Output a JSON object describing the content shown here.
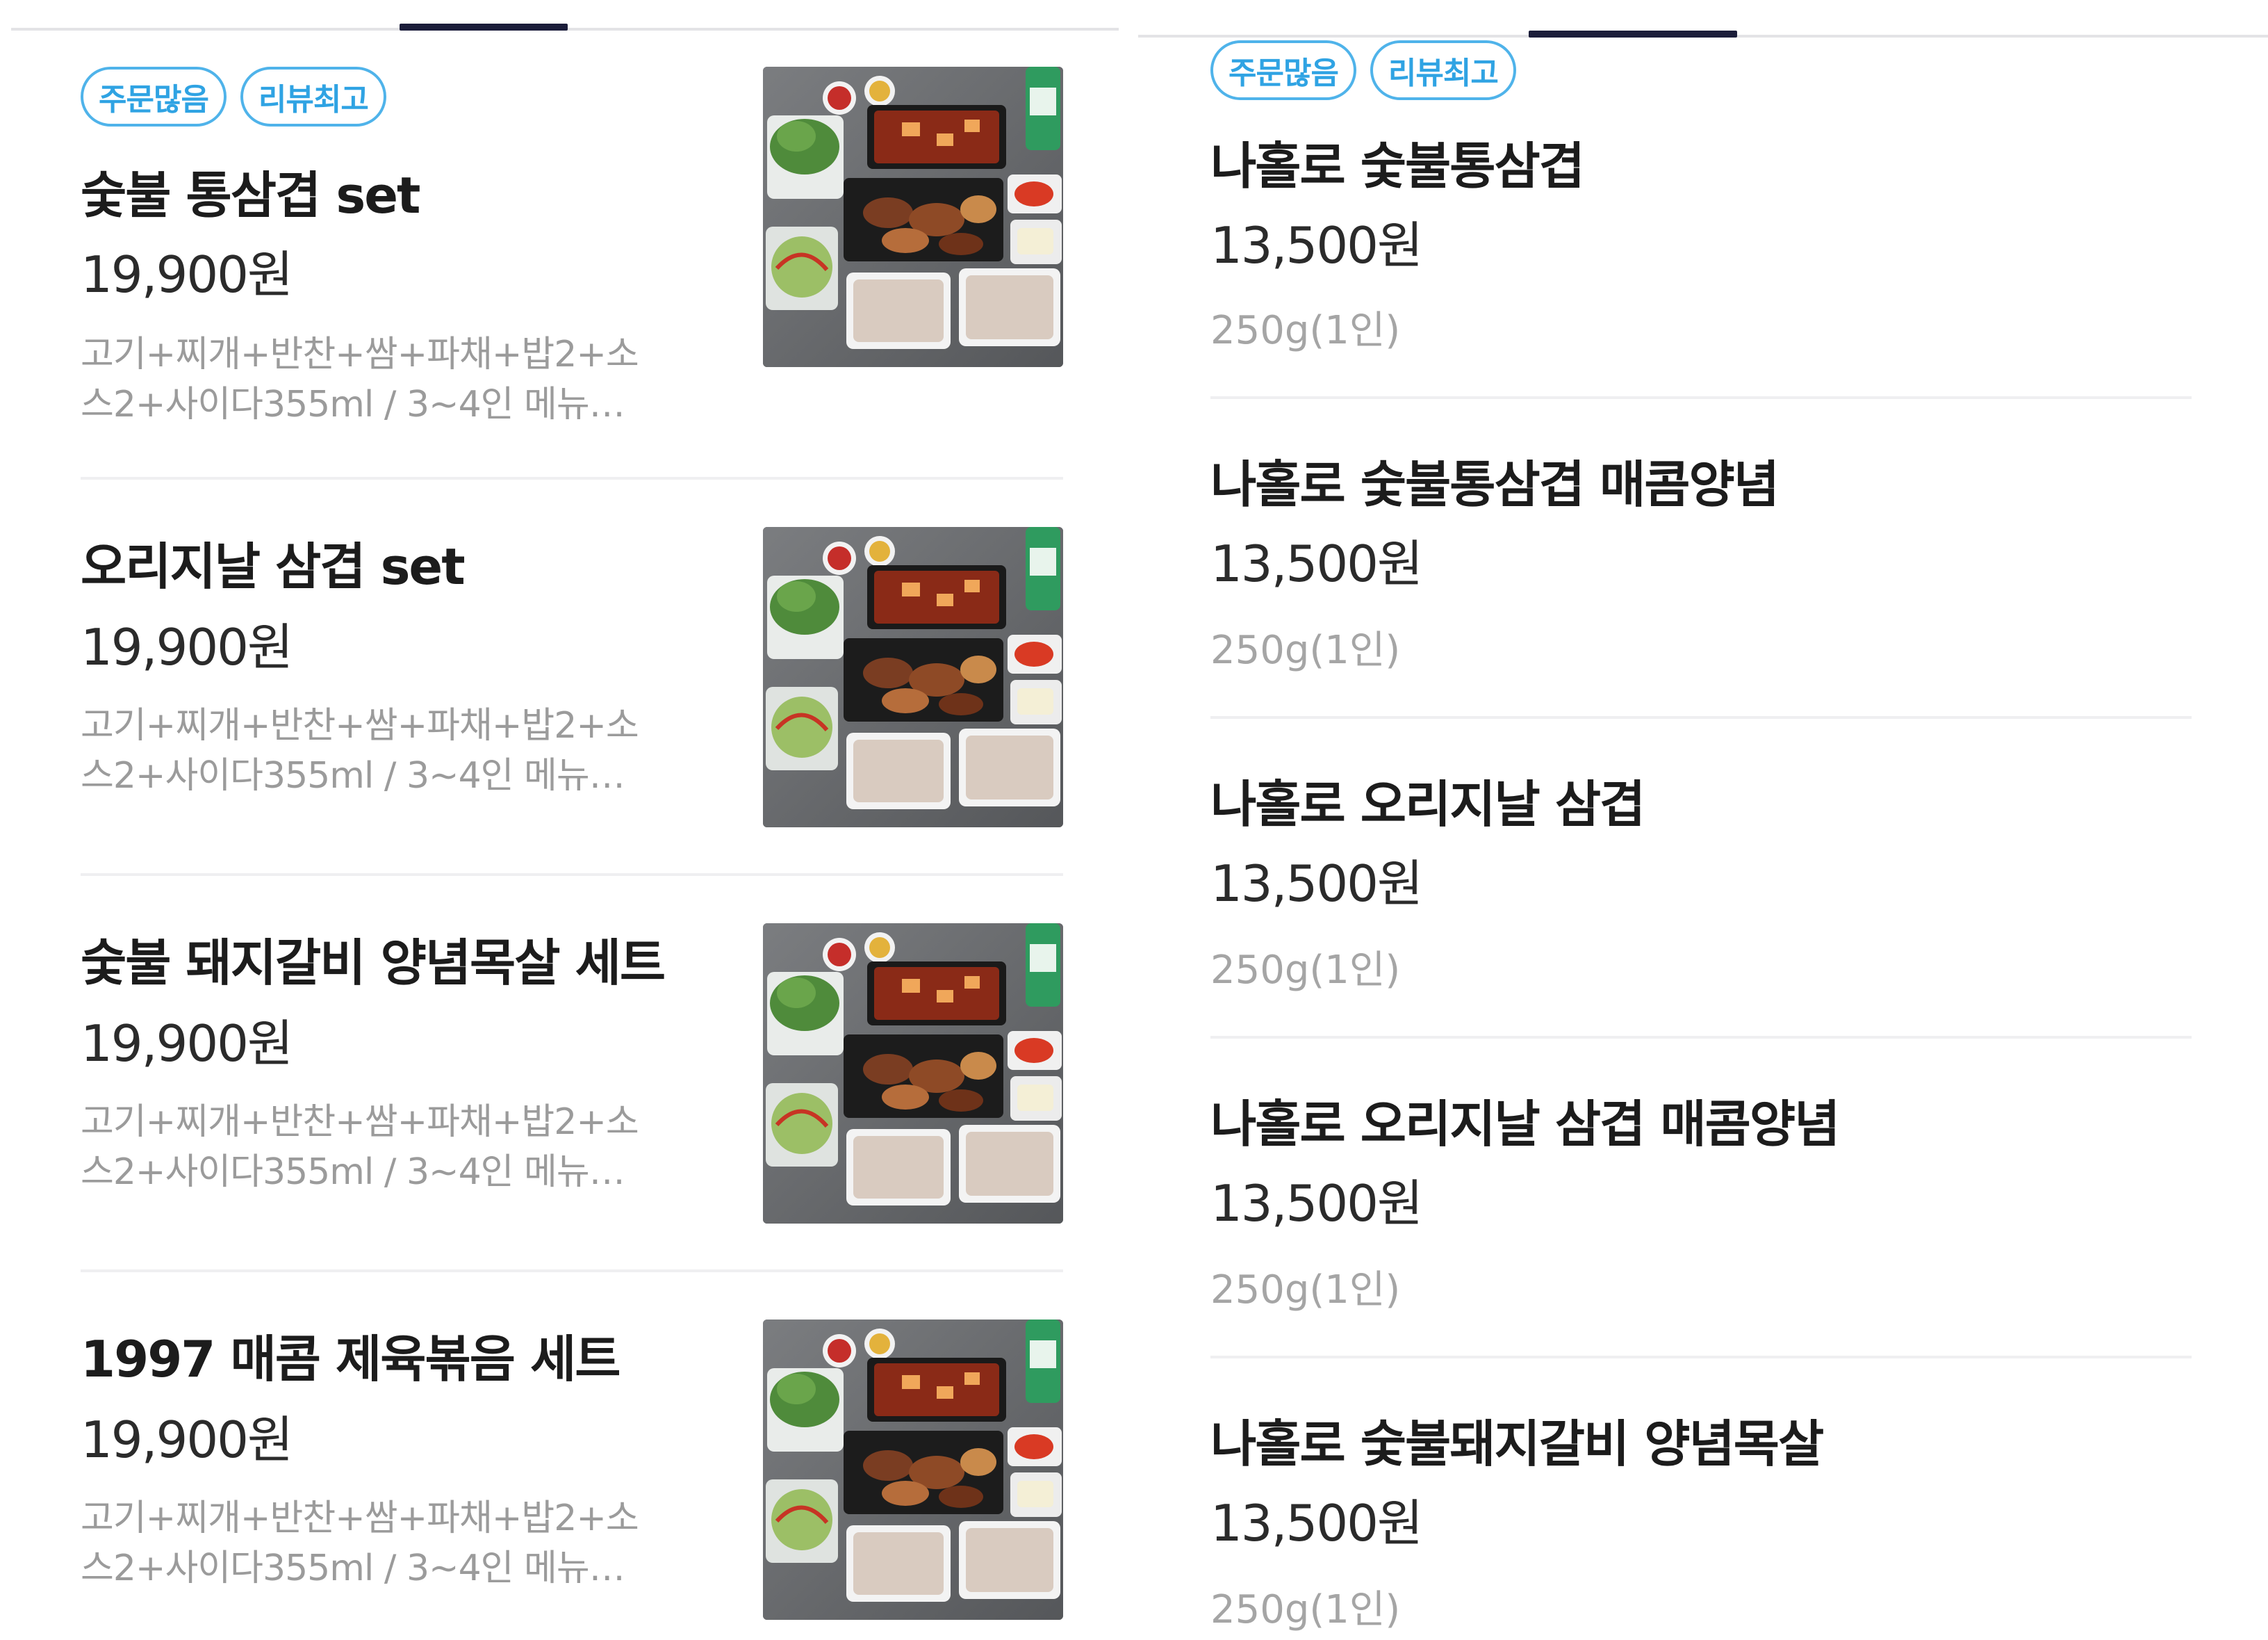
{
  "left": {
    "badges": [
      "주문많음",
      "리뷰최고"
    ],
    "items": [
      {
        "title": "숯불 통삼겹 set",
        "price": "19,900원",
        "desc1": "고기+찌개+반찬+쌈+파채+밥2+소",
        "desc2": "스2+사이다355ml / 3~4인 메뉴…",
        "image": "meat-set-photo"
      },
      {
        "title": "오리지날 삼겹 set",
        "price": "19,900원",
        "desc1": "고기+찌개+반찬+쌈+파채+밥2+소",
        "desc2": "스2+사이다355ml / 3~4인 메뉴…",
        "image": "meat-set-photo"
      },
      {
        "title": "숯불 돼지갈비 양념목살 세트",
        "price": "19,900원",
        "desc1": "고기+찌개+반찬+쌈+파채+밥2+소",
        "desc2": "스2+사이다355ml / 3~4인 메뉴…",
        "image": "meat-set-photo"
      },
      {
        "title": "1997 매콤 제육볶음 세트",
        "price": "19,900원",
        "desc1": "고기+찌개+반찬+쌈+파채+밥2+소",
        "desc2": "스2+사이다355ml / 3~4인 메뉴…",
        "image": "meat-set-photo"
      }
    ]
  },
  "right": {
    "badges": [
      "주문많음",
      "리뷰최고"
    ],
    "items": [
      {
        "title": "나홀로 숯불통삼겹",
        "price": "13,500원",
        "weight": "250g(1인)"
      },
      {
        "title": "나홀로 숯불통삼겹 매콤양념",
        "price": "13,500원",
        "weight": "250g(1인)"
      },
      {
        "title": "나홀로 오리지날 삼겹",
        "price": "13,500원",
        "weight": "250g(1인)"
      },
      {
        "title": "나홀로 오리지날 삼겹 매콤양념",
        "price": "13,500원",
        "weight": "250g(1인)"
      },
      {
        "title": "나홀로 숯불돼지갈비 양념목살",
        "price": "13,500원",
        "weight": "250g(1인)"
      }
    ]
  },
  "colors": {
    "badge_border": "#4fb3ea",
    "badge_text": "#2fa3e3",
    "tab_active": "#1b1d3a",
    "price_text": "#2b2b2b",
    "desc_text": "#9b9b9b"
  }
}
